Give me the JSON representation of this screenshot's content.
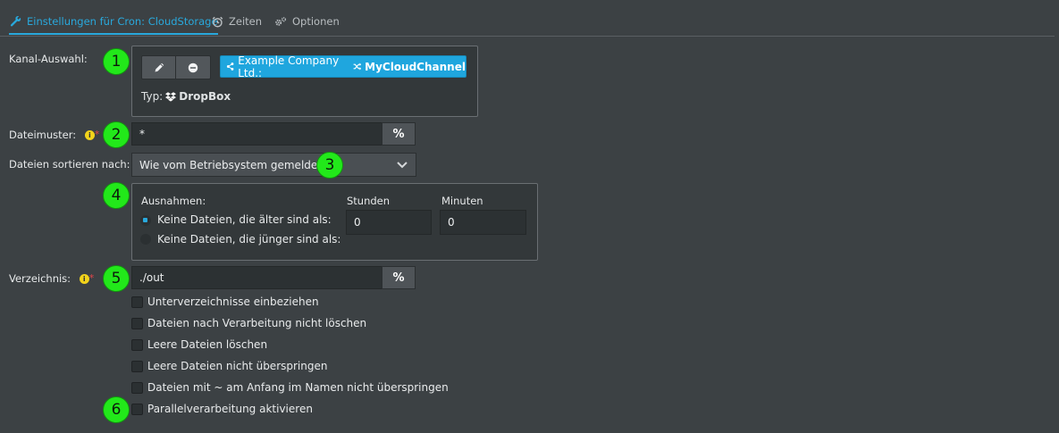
{
  "tabs": [
    {
      "label": "Einstellungen für Cron: CloudStorage",
      "icon": "wrench-icon",
      "active": true
    },
    {
      "label": "Zeiten",
      "icon": "alarm-clock-icon",
      "active": false
    },
    {
      "label": "Optionen",
      "icon": "gears-icon",
      "active": false
    }
  ],
  "channel": {
    "label": "Kanal-Auswahl:",
    "company": "Example Company Ltd.:",
    "name": "MyCloudChannel",
    "type_label": "Typ:",
    "type_value": "DropBox",
    "accent": "#1fa6de"
  },
  "pattern": {
    "label": "Dateimuster:",
    "value": "*",
    "pct": "%"
  },
  "sort": {
    "label": "Dateien sortieren nach:",
    "value": "Wie vom Betriebsystem gemeldet"
  },
  "exceptions": {
    "title": "Ausnahmen:",
    "options": [
      "Keine Dateien, die älter sind als:",
      "Keine Dateien, die jünger sind als:"
    ],
    "selected_index": 0,
    "hours_label": "Stunden",
    "hours_value": "0",
    "minutes_label": "Minuten",
    "minutes_value": "0"
  },
  "directory": {
    "label": "Verzeichnis:",
    "value": "./out",
    "pct": "%"
  },
  "checkboxes": [
    "Unterverzeichnisse einbeziehen",
    "Dateien nach Verarbeitung nicht löschen",
    "Leere Dateien löschen",
    "Leere Dateien nicht überspringen",
    "Dateien mit ~ am Anfang im Namen nicht überspringen",
    "Parallelverarbeitung aktivieren"
  ],
  "markers": [
    "1",
    "2",
    "3",
    "4",
    "5",
    "6"
  ],
  "info_glyph": "i",
  "required_glyph": "*"
}
